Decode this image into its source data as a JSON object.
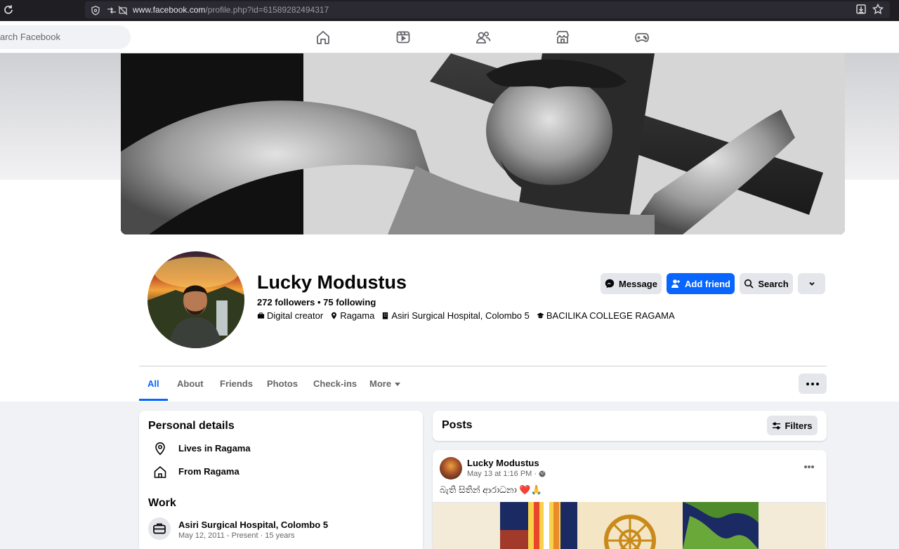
{
  "browser": {
    "url_host": "www.facebook.com",
    "url_path": "/profile.php?id=61589282494317"
  },
  "nav": {
    "search_placeholder": "arch Facebook",
    "icons": [
      "home-icon",
      "video-icon",
      "friends-icon",
      "marketplace-icon",
      "gaming-icon"
    ]
  },
  "profile": {
    "name": "Lucky Modustus",
    "followers": "272 followers",
    "separator": " • ",
    "following": "75 following",
    "details": {
      "category": "Digital creator",
      "location": "Ragama",
      "work": "Asiri Surgical Hospital, Colombo 5",
      "education": "BACILIKA COLLEGE RAGAMA"
    },
    "actions": {
      "message": "Message",
      "add_friend": "Add friend",
      "search": "Search"
    }
  },
  "tabs": {
    "all": "All",
    "about": "About",
    "friends": "Friends",
    "photos": "Photos",
    "checkins": "Check-ins",
    "more": "More"
  },
  "personal_details": {
    "title": "Personal details",
    "lives_in": "Lives in Ragama",
    "from": "From Ragama"
  },
  "work": {
    "title": "Work",
    "employer": "Asiri Surgical Hospital, Colombo 5",
    "period": "May 12, 2011 - Present · 15 years"
  },
  "posts": {
    "title": "Posts",
    "filters": "Filters",
    "post": {
      "author": "Lucky Modustus",
      "timestamp": "May 13 at 1:16 PM ·",
      "text": "බැති සිතින් ආරාධනා ❤️🙏"
    }
  },
  "colors": {
    "primary": "#0866ff",
    "secondary_button": "#e4e6eb",
    "page_bg": "#f0f2f5"
  }
}
